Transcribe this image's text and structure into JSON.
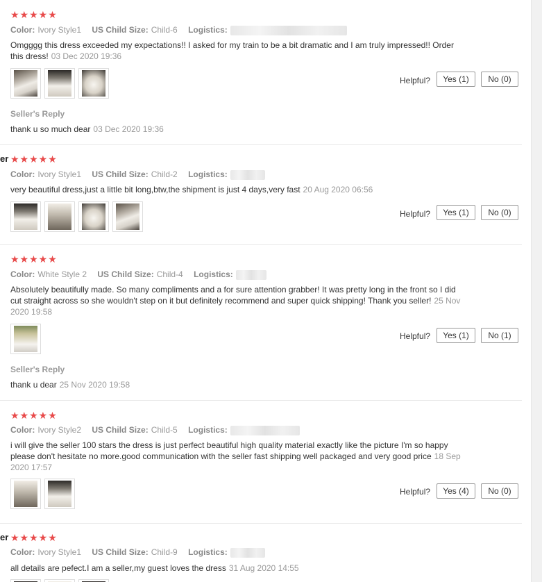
{
  "labels": {
    "color": "Color:",
    "size": "US Child Size:",
    "logistics": "Logistics:",
    "helpful": "Helpful?",
    "seller_reply": "Seller's Reply",
    "er": "er"
  },
  "star_rating": "★★★★★",
  "reviews": [
    {
      "stars": 5,
      "color": "Ivory Style1",
      "size": "Child-6",
      "text": "Omgggg this dress exceeded my expectations!! I asked for my train to be a bit dramatic and I am truly impressed!! Order this dress!",
      "date": "03 Dec 2020 19:36",
      "yes": "Yes (1)",
      "no": "No (0)",
      "reply": "thank u so much dear",
      "reply_date": "03 Dec 2020 19:36"
    },
    {
      "stars": 5,
      "color": "Ivory Style1",
      "size": "Child-2",
      "text": "very beautiful dress,just a little bit long,btw,the shipment is just 4 days,very fast",
      "date": "20 Aug 2020 06:56",
      "yes": "Yes (1)",
      "no": "No (0)"
    },
    {
      "stars": 5,
      "color": "White Style 2",
      "size": "Child-4",
      "text": "Absolutely beautifully made. So many compliments and a for sure attention grabber! It was pretty long in the front so I did cut straight across so she wouldn't step on it but definitely recommend and super quick shipping! Thank you seller!",
      "date": "25 Nov 2020 19:58",
      "yes": "Yes (1)",
      "no": "No (1)",
      "reply": "thank u dear",
      "reply_date": "25 Nov 2020 19:58"
    },
    {
      "stars": 5,
      "color": "Ivory Style2",
      "size": "Child-5",
      "text": "i will give the seller 100 stars the dress is just perfect beautiful high quality material exactly like the picture I'm so happy please don't hesitate no more.good communication with the seller fast shipping well packaged and very good price",
      "date": "18 Sep 2020 17:57",
      "yes": "Yes (4)",
      "no": "No (0)"
    },
    {
      "stars": 5,
      "color": "Ivory Style1",
      "size": "Child-9",
      "text": "all details are pefect.I am a seller,my guest loves the dress",
      "date": "31 Aug 2020 14:55"
    }
  ]
}
